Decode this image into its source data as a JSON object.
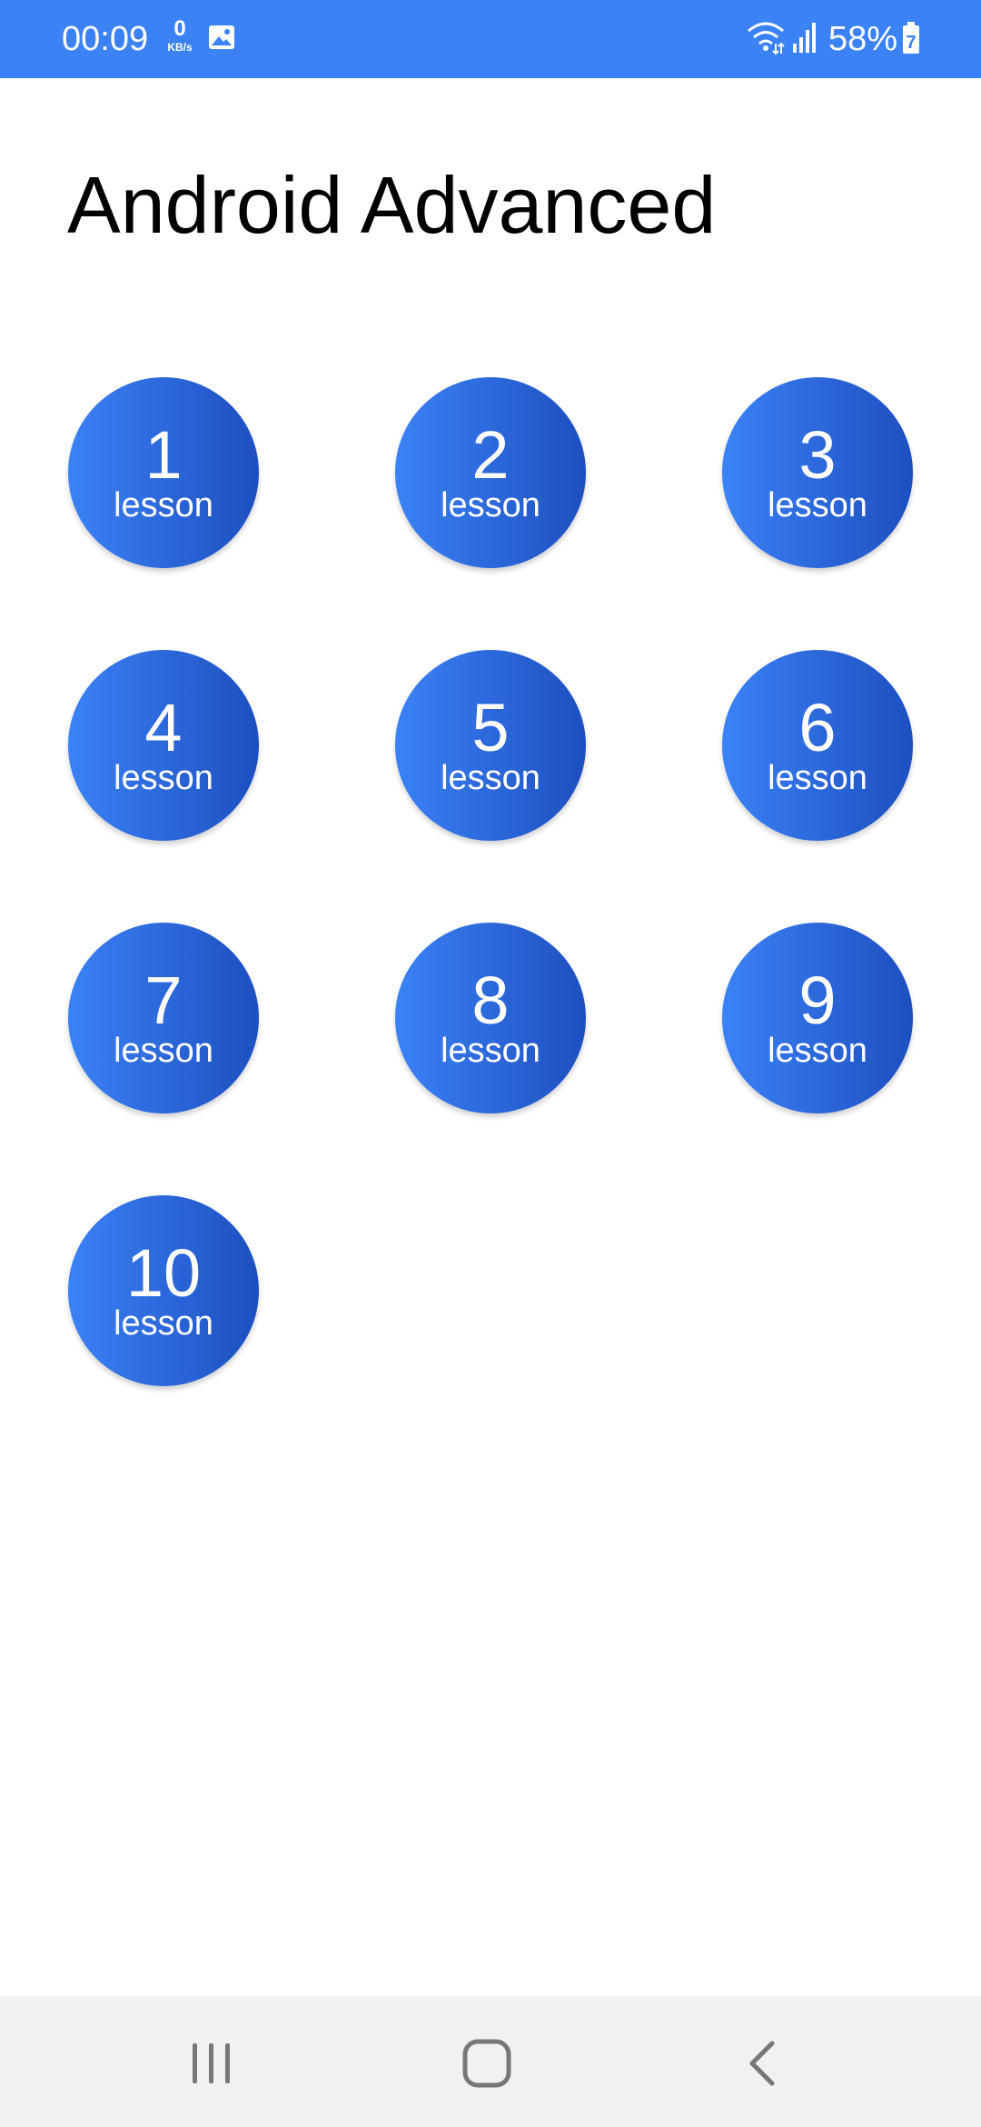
{
  "status_bar": {
    "time": "00:09",
    "net_speed_value": "0",
    "net_speed_unit": "KB/s",
    "battery_percent": "58%",
    "battery_level_label": "7",
    "icons": [
      "gallery-icon",
      "wifi-icon",
      "signal-icon",
      "battery-icon"
    ],
    "background_color": "#3B82F6"
  },
  "page": {
    "title": "Android Advanced"
  },
  "lessons": [
    {
      "number": "1",
      "label": "lesson"
    },
    {
      "number": "2",
      "label": "lesson"
    },
    {
      "number": "3",
      "label": "lesson"
    },
    {
      "number": "4",
      "label": "lesson"
    },
    {
      "number": "5",
      "label": "lesson"
    },
    {
      "number": "6",
      "label": "lesson"
    },
    {
      "number": "7",
      "label": "lesson"
    },
    {
      "number": "8",
      "label": "lesson"
    },
    {
      "number": "9",
      "label": "lesson"
    },
    {
      "number": "10",
      "label": "lesson"
    }
  ],
  "lesson_button_colors": {
    "gradient_start": "#3B82F6",
    "gradient_end": "#1D4FC0"
  },
  "nav_bar": {
    "icons": [
      "recents-icon",
      "home-icon",
      "back-icon"
    ]
  }
}
